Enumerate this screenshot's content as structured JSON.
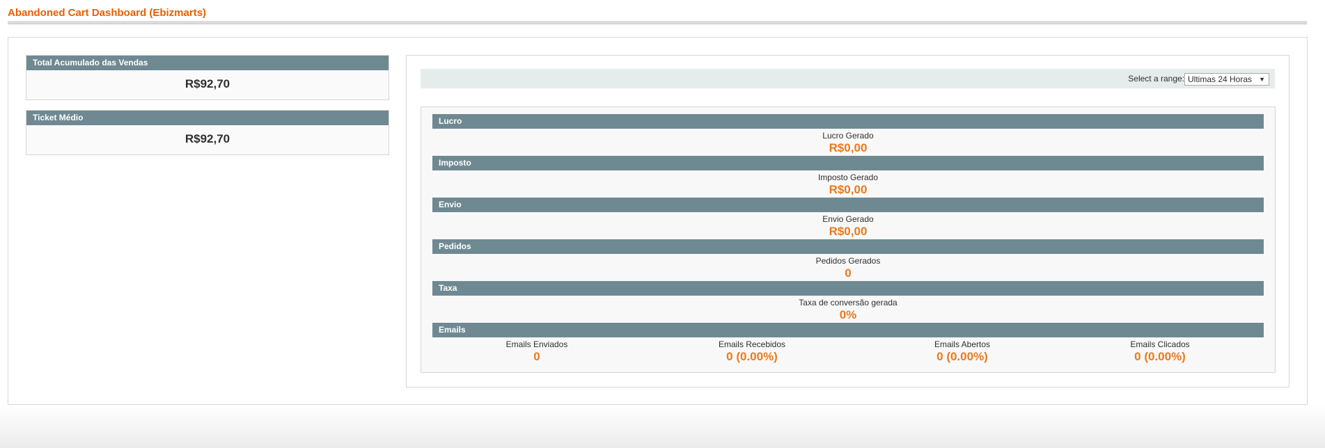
{
  "page": {
    "title": "Abandoned Cart Dashboard (Ebizmarts)"
  },
  "left_widgets": [
    {
      "label": "Total Acumulado das Vendas",
      "value": "R$92,70"
    },
    {
      "label": "Ticket Médio",
      "value": "R$92,70"
    }
  ],
  "range": {
    "label": "Select a range:",
    "selected": "Ultimas 24 Horas"
  },
  "sections": {
    "lucro": {
      "title": "Lucro",
      "label": "Lucro Gerado",
      "value": "R$0,00"
    },
    "imposto": {
      "title": "Imposto",
      "label": "Imposto Gerado",
      "value": "R$0,00"
    },
    "envio": {
      "title": "Envio",
      "label": "Envio Gerado",
      "value": "R$0,00"
    },
    "pedidos": {
      "title": "Pedidos",
      "label": "Pedidos Gerados",
      "value": "0"
    },
    "taxa": {
      "title": "Taxa",
      "label": "Taxa de conversão gerada",
      "value": "0%"
    }
  },
  "emails": {
    "title": "Emails",
    "items": [
      {
        "label": "Emails Enviados",
        "value": "0"
      },
      {
        "label": "Emails Recebidos",
        "value": "0 (0.00%)"
      },
      {
        "label": "Emails Abertos",
        "value": "0 (0.00%)"
      },
      {
        "label": "Emails Clicados",
        "value": "0 (0.00%)"
      }
    ]
  },
  "colors": {
    "accent": "#eb5e00",
    "value_orange": "#eb7a1b",
    "header_bar": "#6f8992"
  }
}
